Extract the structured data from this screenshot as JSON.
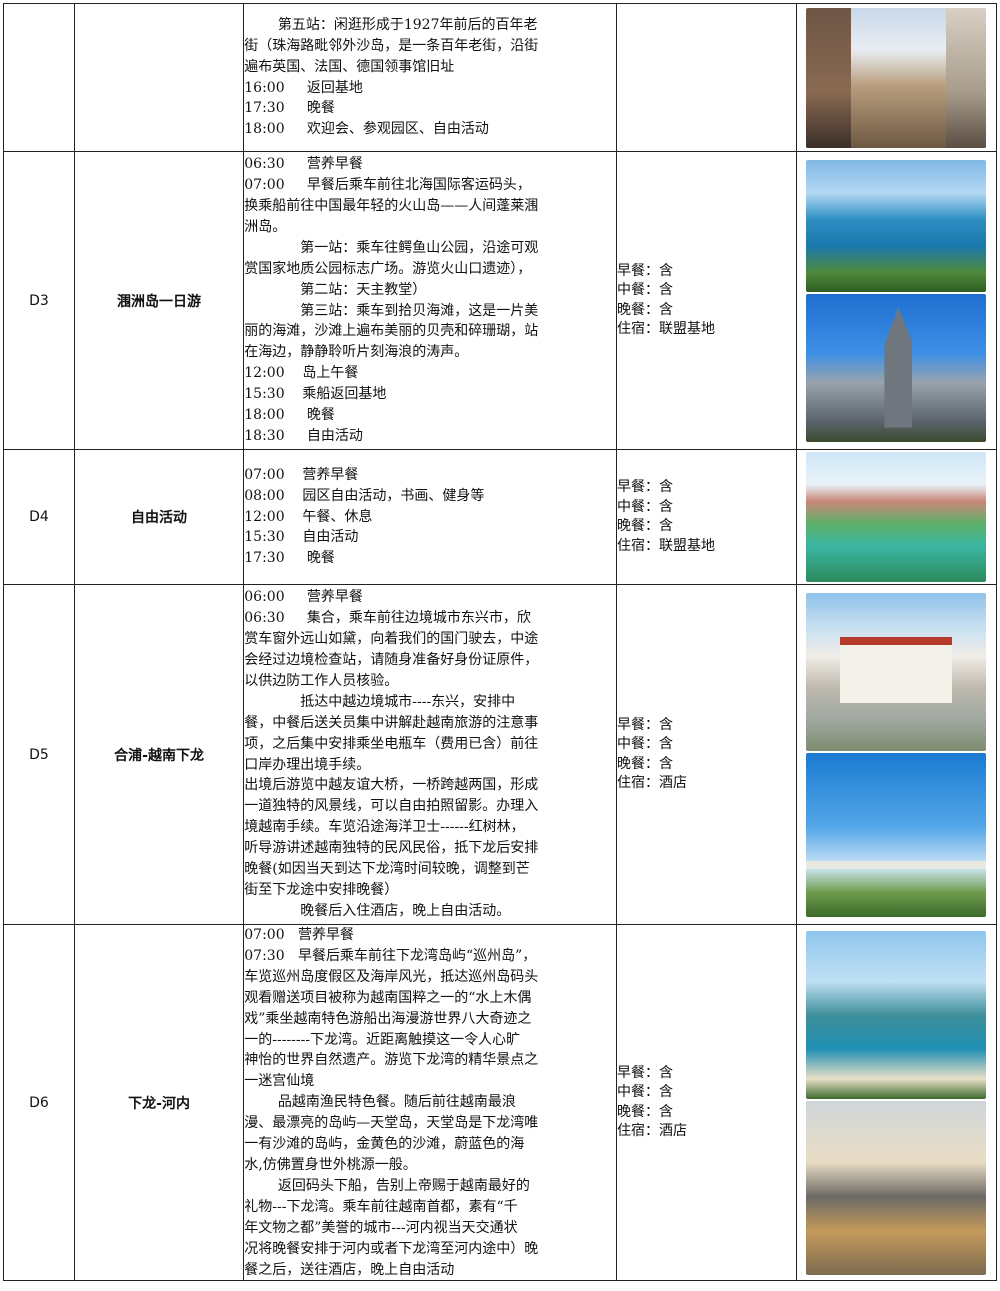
{
  "rows": [
    {
      "day": "",
      "title": "",
      "schedule": [
        {
          "text": "第五站：闲逛形成于1927年前后的百年老",
          "indent": "ind"
        },
        {
          "text": "街（珠海路毗邻外沙岛，是一条百年老街，沿街",
          "indent": ""
        },
        {
          "text": "遍布英国、法国、德国领事馆旧址",
          "indent": ""
        },
        {
          "text": "16:00     返回基地",
          "indent": ""
        },
        {
          "text": "17:30     晚餐",
          "indent": ""
        },
        {
          "text": "18:00     欢迎会、参观园区、自由活动",
          "indent": ""
        }
      ],
      "meals": [],
      "photos": [
        "old-street-photo"
      ]
    },
    {
      "day": "D3",
      "title": "涠洲岛一日游",
      "schedule": [
        {
          "text": "06:30     营养早餐",
          "indent": ""
        },
        {
          "text": "07:00     早餐后乘车前往北海国际客运码头，",
          "indent": ""
        },
        {
          "text": "换乘船前往中国最年轻的火山岛——人间蓬莱涠",
          "indent": ""
        },
        {
          "text": "洲岛。",
          "indent": ""
        },
        {
          "text": "第一站：乘车往鳄鱼山公园，沿途可观",
          "indent": "ind2"
        },
        {
          "text": "赏国家地质公园标志广场。游览火山口遗迹），",
          "indent": ""
        },
        {
          "text": "第二站：天主教堂）",
          "indent": "ind2"
        },
        {
          "text": "第三站：乘车到拾贝海滩，这是一片美",
          "indent": "ind2"
        },
        {
          "text": "丽的海滩，沙滩上遍布美丽的贝壳和碎珊瑚，站",
          "indent": ""
        },
        {
          "text": "在海边，静静聆听片刻海浪的涛声。",
          "indent": ""
        },
        {
          "text": "12:00    岛上午餐",
          "indent": ""
        },
        {
          "text": "15:30    乘船返回基地",
          "indent": ""
        },
        {
          "text": "18:00     晚餐",
          "indent": ""
        },
        {
          "text": "18:30     自由活动",
          "indent": ""
        }
      ],
      "meals": [
        "早餐：含",
        "中餐：含",
        "晚餐：含",
        "住宿：联盟基地"
      ],
      "photos": [
        "weizhou-coast-photo",
        "weizhou-church-photo"
      ]
    },
    {
      "day": "D4",
      "title": "自由活动",
      "schedule": [
        {
          "text": "07:00    营养早餐",
          "indent": ""
        },
        {
          "text": "08:00    园区自由活动，书画、健身等",
          "indent": ""
        },
        {
          "text": "12:00    午餐、休息",
          "indent": ""
        },
        {
          "text": "15:30    自由活动",
          "indent": ""
        },
        {
          "text": "17:30     晚餐",
          "indent": ""
        }
      ],
      "meals": [
        "早餐：含",
        "中餐：含",
        "晚餐：含",
        "住宿：联盟基地"
      ],
      "photos": [
        "base-lake-photo"
      ]
    },
    {
      "day": "D5",
      "title": "合浦-越南下龙",
      "schedule": [
        {
          "text": "06:00     营养早餐",
          "indent": ""
        },
        {
          "text": "06:30     集合，乘车前往边境城市东兴市，欣",
          "indent": ""
        },
        {
          "text": "赏车窗外远山如黛，向着我们的国门驶去，中途",
          "indent": ""
        },
        {
          "text": "会经过边境检查站，请随身准备好身份证原件，",
          "indent": ""
        },
        {
          "text": "以供边防工作人员核验。",
          "indent": ""
        },
        {
          "text": "抵达中越边境城市----东兴，安排中",
          "indent": "ind2"
        },
        {
          "text": "餐，中餐后送关员集中讲解赴越南旅游的注意事",
          "indent": ""
        },
        {
          "text": "项，之后集中安排乘坐电瓶车（费用已含）前往",
          "indent": ""
        },
        {
          "text": "口岸办理出境手续。",
          "indent": ""
        },
        {
          "text": "出境后游览中越友谊大桥，一桥跨越两国，形成",
          "indent": ""
        },
        {
          "text": "一道独特的风景线，可以自由拍照留影。办理入",
          "indent": ""
        },
        {
          "text": "境越南手续。车览沿途海洋卫士------红树林，",
          "indent": ""
        },
        {
          "text": "听导游讲述越南独特的民风民俗，抵下龙后安排",
          "indent": ""
        },
        {
          "text": "晚餐(如因当天到达下龙湾时间较晚，调整到芒",
          "indent": ""
        },
        {
          "text": "街至下龙途中安排晚餐）",
          "indent": ""
        },
        {
          "text": "晚餐后入住酒店，晚上自由活动。",
          "indent": "ind2"
        }
      ],
      "meals": [
        "早餐：含",
        "中餐：含",
        "晚餐：含",
        "住宿：酒店"
      ],
      "photos": [
        "dongxing-border-gate-photo",
        "friendship-bridge-photo"
      ]
    },
    {
      "day": "D6",
      "title": "下龙-河内",
      "schedule": [
        {
          "text": "07:00   营养早餐",
          "indent": ""
        },
        {
          "text": "07:30   早餐后乘车前往下龙湾岛屿“巡州岛”，",
          "indent": ""
        },
        {
          "text": "车览巡州岛度假区及海岸风光，抵达巡州岛码头",
          "indent": ""
        },
        {
          "text": "观看赠送项目被称为越南国粹之一的“水上木偶",
          "indent": ""
        },
        {
          "text": "戏”乘坐越南特色游船出海漫游世界八大奇迹之",
          "indent": ""
        },
        {
          "text": "一的--------下龙湾。近距离触摸这一令人心旷",
          "indent": ""
        },
        {
          "text": "神怡的世界自然遗产。游览下龙湾的精华景点之",
          "indent": ""
        },
        {
          "text": "一迷宫仙境",
          "indent": ""
        },
        {
          "text": "品越南渔民特色餐。随后前往越南最浪",
          "indent": "ind"
        },
        {
          "text": "漫、最漂亮的岛屿—天堂岛，天堂岛是下龙湾唯",
          "indent": ""
        },
        {
          "text": "一有沙滩的岛屿，金黄色的沙滩，蔚蓝色的海",
          "indent": ""
        },
        {
          "text": "水,仿佛置身世外桃源一般。",
          "indent": ""
        },
        {
          "text": "返回码头下船，告别上帝赐于越南最好的",
          "indent": "ind"
        },
        {
          "text": "礼物---下龙湾。乘车前往越南首都，素有“千",
          "indent": ""
        },
        {
          "text": "年文物之都”美誉的城市---河内视当天交通状",
          "indent": ""
        },
        {
          "text": "况将晚餐安排于河内或者下龙湾至河内途中）晚",
          "indent": ""
        },
        {
          "text": "餐之后，送往酒店，晚上自由活动",
          "indent": ""
        }
      ],
      "meals": [
        "早餐：含",
        "中餐：含",
        "晚餐：含",
        "住宿：酒店"
      ],
      "photos": [
        "halong-bay-beach-photo",
        "halong-junk-sunset-photo"
      ]
    }
  ]
}
